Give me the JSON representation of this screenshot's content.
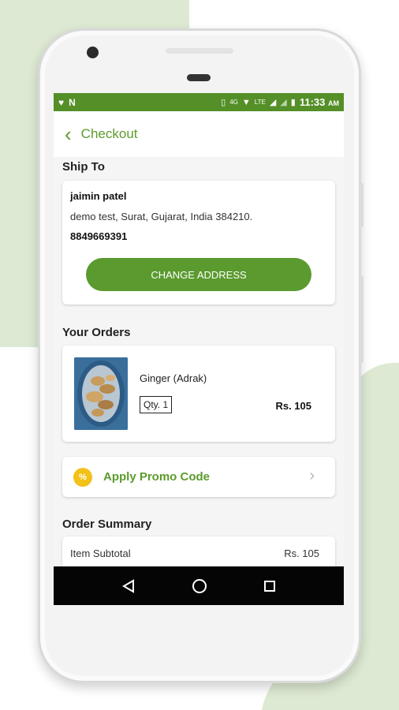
{
  "statusbar": {
    "left_icons": [
      "♥",
      "N"
    ],
    "right_icons": [
      "▯",
      "4G",
      "▼",
      "LTE",
      "◢",
      "◢",
      "▮"
    ],
    "time": "11:33",
    "ampm": "AM"
  },
  "appbar": {
    "back_icon": "‹",
    "title": "Checkout"
  },
  "ship_to": {
    "heading": "Ship To",
    "name": "jaimin patel",
    "address": "demo test, Surat, Gujarat, India 384210.",
    "phone": "8849669391",
    "change_button": "CHANGE ADDRESS"
  },
  "orders": {
    "heading": "Your Orders",
    "items": [
      {
        "name": "Ginger (Adrak)",
        "qty": "Qty. 1",
        "price": "Rs. 105"
      }
    ]
  },
  "promo": {
    "icon": "%",
    "label": "Apply Promo Code",
    "chevron": "›"
  },
  "summary": {
    "heading": "Order Summary",
    "rows": [
      {
        "label": "Item Subtotal",
        "value": "Rs. 105"
      }
    ]
  },
  "colors": {
    "brand_green": "#5a9a2e",
    "statusbar_green": "#548f27",
    "promo_yellow": "#f2c21b",
    "background_green": "#dde9d2"
  }
}
